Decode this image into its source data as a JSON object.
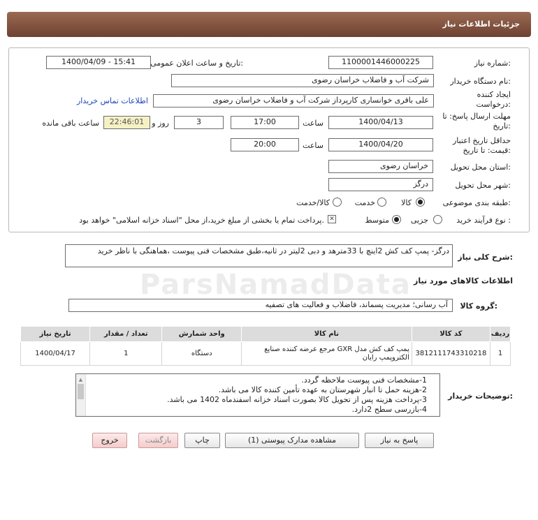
{
  "header": {
    "title": "جزئیات اطلاعات نیاز"
  },
  "fields": {
    "need_number_label": "شماره نیاز:",
    "need_number": "1100001446000225",
    "announce_label": "تاریخ و ساعت اعلان عمومی:",
    "announce_value": "1400/04/09 - 15:41",
    "buyer_label": "نام دستگاه خریدار:",
    "buyer_value": "شرکت آب و فاضلاب خراسان رضوی",
    "creator_label": "ایجاد کننده درخواست:",
    "creator_value": "علی باقری خوانساری کارپرداز شرکت آب و فاضلاب خراسان رضوی",
    "contact_link": "اطلاعات تماس خریدار",
    "deadline_label": "مهلت ارسال پاسخ: تا تاریخ:",
    "deadline_date": "1400/04/13",
    "time_label": "ساعت",
    "deadline_time": "17:00",
    "days_value": "3",
    "days_label": "روز و",
    "remaining_time": "22:46:01",
    "remaining_label": "ساعت باقی مانده",
    "validity_label": "حداقل تاریخ اعتبار قیمت: تا تاریخ:",
    "validity_date": "1400/04/20",
    "validity_time": "20:00",
    "province_label": "استان محل تحویل:",
    "province_value": "خراسان رضوی",
    "city_label": "شهر محل تحویل:",
    "city_value": "درگز",
    "category_label": "طبقه بندی موضوعی:",
    "category_options": [
      "کالا",
      "خدمت",
      "کالا/خدمت"
    ],
    "process_label": "نوع فرآیند خرید :",
    "process_options": [
      "جزیی",
      "متوسط"
    ],
    "payment_note": "پرداخت تمام یا بخشی از مبلغ خرید،از محل \"اسناد خزانه اسلامی\" خواهد بود."
  },
  "description": {
    "label": "شرح کلی نیاز:",
    "text": "درگز- پمپ کف کش 2اینچ با 33مترهد و دبی 2لیتر در ثانیه،طبق مشخصات فنی پیوست ،هماهنگی با ناظر خرید"
  },
  "goods": {
    "section_title": "اطلاعات کالاهای مورد نیاز",
    "group_label": "گروه کالا:",
    "group_value": "آب رسانی؛ مدیریت پسماند، فاضلاب و فعالیت های تصفیه",
    "columns": [
      "ردیف",
      "کد کالا",
      "نام کالا",
      "واحد شمارش",
      "تعداد / مقدار",
      "تاریخ نیاز"
    ],
    "rows": [
      {
        "index": "1",
        "code": "3812111743310218",
        "name": "پمپ کف کش مدل GXR مرجع عرضه کننده صنایع الکتروپمپ رایان",
        "unit": "دستگاه",
        "qty": "1",
        "date": "1400/04/17"
      }
    ]
  },
  "notes": {
    "label": "توضیحات خریدار:",
    "lines": [
      "1-مشخصات فنی پیوست ملاحظه گردد.",
      "2-هزینه حمل تا انبار شهرستان به عهده تأمین کننده کالا می باشد.",
      "3-پرداخت هزینه پس از تحویل کالا بصورت اسناد خزانه اسفندماه 1402 می باشد.",
      "4-بازرسی سطح 2دارد."
    ]
  },
  "buttons": {
    "reply": "پاسخ به نیاز",
    "attachments": "مشاهده مدارک پیوستی (1)",
    "print": "چاپ",
    "back": "بازگشت",
    "exit": "خروج"
  },
  "watermark": "ParsNamadData"
}
